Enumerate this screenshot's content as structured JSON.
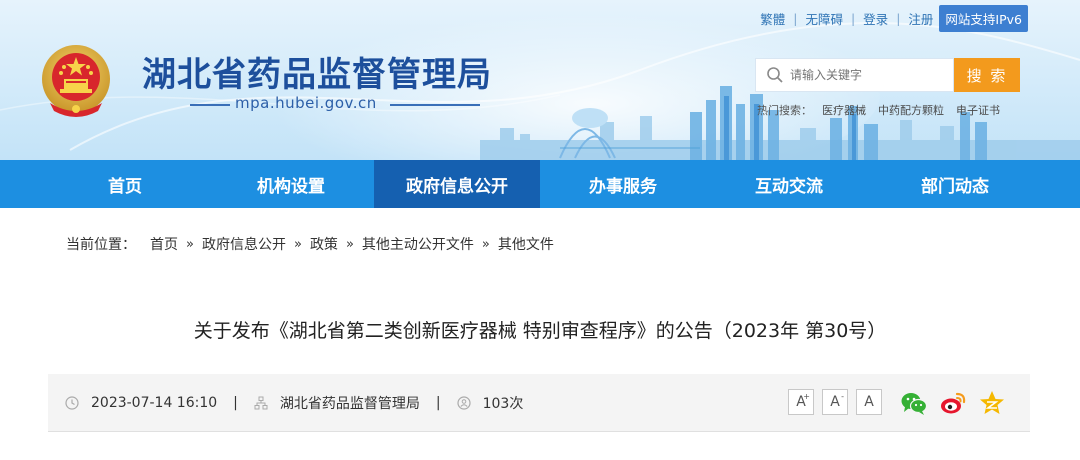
{
  "top_links": {
    "traditional": "繁體",
    "accessible": "无障碍",
    "login": "登录",
    "register": "注册",
    "ipv6": "网站支持IPv6"
  },
  "site": {
    "title": "湖北省药品监督管理局",
    "domain": "mpa.hubei.gov.cn"
  },
  "search": {
    "placeholder": "请输入关键字",
    "button": "搜 索",
    "hot_label": "热门搜索：",
    "hot_terms": [
      "医疗器械",
      "中药配方颗粒",
      "电子证书"
    ]
  },
  "nav": {
    "items": [
      "首页",
      "机构设置",
      "政府信息公开",
      "办事服务",
      "互动交流",
      "部门动态"
    ],
    "active_index": 2
  },
  "breadcrumb": {
    "prefix": "当前位置：",
    "items": [
      "首页",
      "政府信息公开",
      "政策",
      "其他主动公开文件",
      "其他文件"
    ],
    "separator": "»"
  },
  "article": {
    "title": "关于发布《湖北省第二类创新医疗器械 特别审查程序》的公告（2023年 第30号）",
    "date": "2023-07-14 16:10",
    "source": "湖北省药品监督管理局",
    "views": "103次"
  },
  "tools": {
    "font_large": "A",
    "font_medium": "A",
    "font_small": "A",
    "share_icons": [
      "wechat-icon",
      "weibo-icon",
      "qzone-icon"
    ]
  },
  "colors": {
    "nav_bg": "#1d8fe1",
    "nav_active": "#1560b0",
    "title_blue": "#1d4f9c",
    "search_button": "#f39a1d",
    "wechat": "#35b035",
    "weibo": "#e6162d",
    "qzone": "#f5b800"
  }
}
